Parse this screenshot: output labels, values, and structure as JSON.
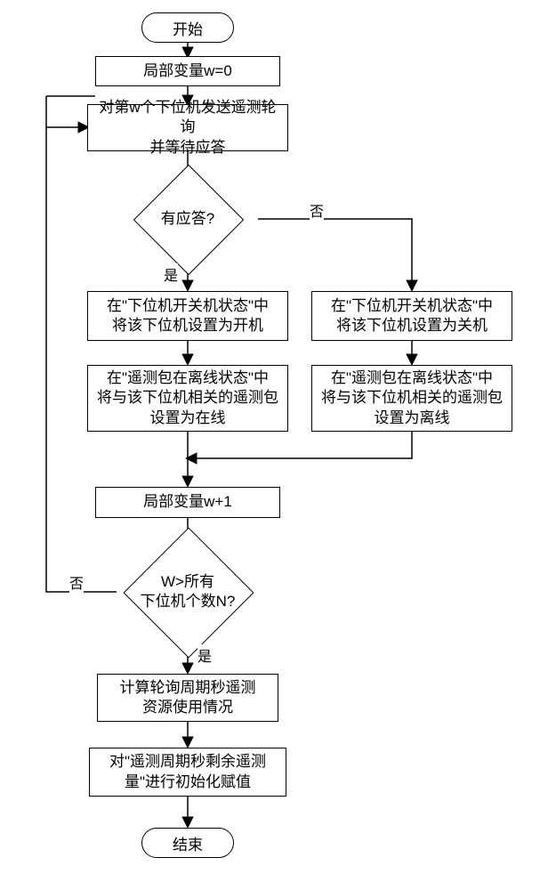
{
  "chart_data": {
    "type": "flowchart",
    "title": "",
    "nodes": [
      {
        "id": "start",
        "type": "terminator",
        "label": "开始"
      },
      {
        "id": "n1",
        "type": "process",
        "label": "局部变量w=0"
      },
      {
        "id": "n2",
        "type": "process",
        "label": "对第w个下位机发送遥测轮询\n并等待应答"
      },
      {
        "id": "d1",
        "type": "decision",
        "label": "有应答?"
      },
      {
        "id": "n3a",
        "type": "process",
        "label": "在\"下位机开关机状态\"中\n将该下位机设置为开机"
      },
      {
        "id": "n3b",
        "type": "process",
        "label": "在\"下位机开关机状态\"中\n将该下位机设置为关机"
      },
      {
        "id": "n4a",
        "type": "process",
        "label": "在\"遥测包在离线状态\"中\n将与该下位机相关的遥测包\n设置为在线"
      },
      {
        "id": "n4b",
        "type": "process",
        "label": "在\"遥测包在离线状态\"中\n将与该下位机相关的遥测包\n设置为离线"
      },
      {
        "id": "n5",
        "type": "process",
        "label": "局部变量w+1"
      },
      {
        "id": "d2",
        "type": "decision",
        "label": "W>所有\n下位机个数N?"
      },
      {
        "id": "n6",
        "type": "process",
        "label": "计算轮询周期秒遥测\n资源使用情况"
      },
      {
        "id": "n7",
        "type": "process",
        "label": "对\"遥测周期秒剩余遥测\n量\"进行初始化赋值"
      },
      {
        "id": "end",
        "type": "terminator",
        "label": "结束"
      }
    ],
    "edges": [
      {
        "from": "start",
        "to": "n1"
      },
      {
        "from": "n1",
        "to": "n2"
      },
      {
        "from": "n2",
        "to": "d1"
      },
      {
        "from": "d1",
        "to": "n3a",
        "label": "是"
      },
      {
        "from": "d1",
        "to": "n3b",
        "label": "否"
      },
      {
        "from": "n3a",
        "to": "n4a"
      },
      {
        "from": "n3b",
        "to": "n4b"
      },
      {
        "from": "n4a",
        "to": "n5"
      },
      {
        "from": "n4b",
        "to": "n5"
      },
      {
        "from": "n5",
        "to": "d2"
      },
      {
        "from": "d2",
        "to": "n6",
        "label": "是"
      },
      {
        "from": "d2",
        "to": "n2",
        "label": "否"
      },
      {
        "from": "n6",
        "to": "n7"
      },
      {
        "from": "n7",
        "to": "end"
      }
    ],
    "labels": {
      "yes": "是",
      "no": "否"
    }
  }
}
